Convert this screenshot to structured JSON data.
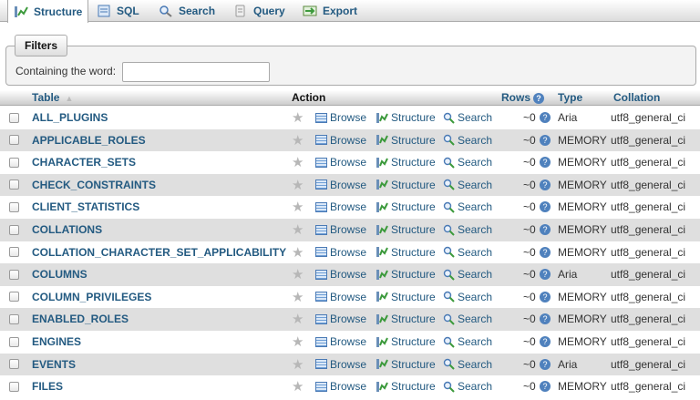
{
  "tabs": [
    {
      "label": "Structure",
      "icon": "structure-icon",
      "active": true
    },
    {
      "label": "SQL",
      "icon": "sql-icon",
      "active": false
    },
    {
      "label": "Search",
      "icon": "search-icon",
      "active": false
    },
    {
      "label": "Query",
      "icon": "query-icon",
      "active": false
    },
    {
      "label": "Export",
      "icon": "export-icon",
      "active": false
    }
  ],
  "filters": {
    "legend": "Filters",
    "label": "Containing the word:",
    "value": ""
  },
  "table": {
    "headers": {
      "table": "Table",
      "action": "Action",
      "rows": "Rows",
      "type": "Type",
      "collation": "Collation"
    },
    "actions": {
      "browse": "Browse",
      "structure": "Structure",
      "search": "Search"
    },
    "rows": [
      {
        "name": "ALL_PLUGINS",
        "rows": "~0",
        "type": "Aria",
        "collation": "utf8_general_ci"
      },
      {
        "name": "APPLICABLE_ROLES",
        "rows": "~0",
        "type": "MEMORY",
        "collation": "utf8_general_ci"
      },
      {
        "name": "CHARACTER_SETS",
        "rows": "~0",
        "type": "MEMORY",
        "collation": "utf8_general_ci"
      },
      {
        "name": "CHECK_CONSTRAINTS",
        "rows": "~0",
        "type": "MEMORY",
        "collation": "utf8_general_ci"
      },
      {
        "name": "CLIENT_STATISTICS",
        "rows": "~0",
        "type": "MEMORY",
        "collation": "utf8_general_ci"
      },
      {
        "name": "COLLATIONS",
        "rows": "~0",
        "type": "MEMORY",
        "collation": "utf8_general_ci"
      },
      {
        "name": "COLLATION_CHARACTER_SET_APPLICABILITY",
        "rows": "~0",
        "type": "MEMORY",
        "collation": "utf8_general_ci"
      },
      {
        "name": "COLUMNS",
        "rows": "~0",
        "type": "Aria",
        "collation": "utf8_general_ci"
      },
      {
        "name": "COLUMN_PRIVILEGES",
        "rows": "~0",
        "type": "MEMORY",
        "collation": "utf8_general_ci"
      },
      {
        "name": "ENABLED_ROLES",
        "rows": "~0",
        "type": "MEMORY",
        "collation": "utf8_general_ci"
      },
      {
        "name": "ENGINES",
        "rows": "~0",
        "type": "MEMORY",
        "collation": "utf8_general_ci"
      },
      {
        "name": "EVENTS",
        "rows": "~0",
        "type": "Aria",
        "collation": "utf8_general_ci"
      },
      {
        "name": "FILES",
        "rows": "~0",
        "type": "MEMORY",
        "collation": "utf8_general_ci"
      }
    ]
  },
  "colors": {
    "link": "#235a81",
    "row_alt": "#dfdfdf",
    "help": "#4f81bd"
  }
}
